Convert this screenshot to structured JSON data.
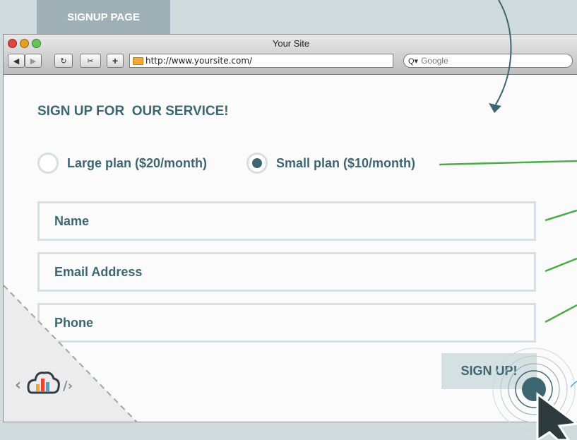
{
  "page_tab": "SIGNUP PAGE",
  "window": {
    "title": "Your Site",
    "url": "http://www.yoursite.com/",
    "search_placeholder": "Google"
  },
  "form": {
    "heading": "SIGN UP FOR  OUR SERVICE!",
    "plans": [
      {
        "label": "Large plan ($20/month)",
        "selected": false
      },
      {
        "label": "Small plan ($10/month)",
        "selected": true
      }
    ],
    "fields": [
      {
        "placeholder": "Name"
      },
      {
        "placeholder": "Email Address"
      },
      {
        "placeholder": "Phone"
      }
    ],
    "submit_label": "SIGN UP!"
  },
  "colors": {
    "accent": "#3d6670",
    "annotation_green": "#4cad47",
    "field_border": "#d5e0e2",
    "background": "#cfdbdc"
  },
  "icons": {
    "logo": "cloud-bar-chart-icon",
    "cursor": "pointer-arrow-icon"
  }
}
